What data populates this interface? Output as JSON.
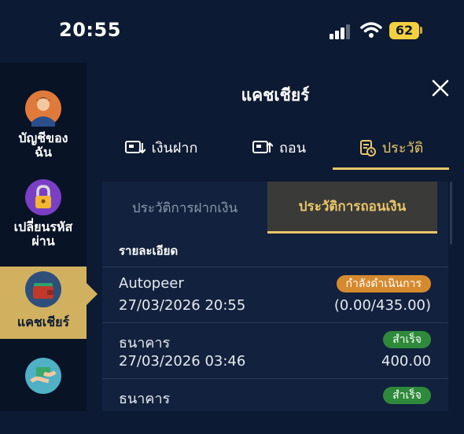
{
  "status": {
    "time": "20:55",
    "battery": "62"
  },
  "sidebar": {
    "items": [
      {
        "label": "บัญชีของฉัน",
        "icon": "user-avatar-icon"
      },
      {
        "label": "เปลี่ยนรหัสผ่าน",
        "icon": "lock-icon"
      },
      {
        "label": "แคชเชียร์",
        "icon": "wallet-icon",
        "active": true
      },
      {
        "label": "",
        "icon": "coin-exchange-icon"
      }
    ]
  },
  "header": {
    "title": "แคชเชียร์"
  },
  "tabs": [
    {
      "label": "เงินฝาก",
      "icon": "deposit-icon"
    },
    {
      "label": "ถอน",
      "icon": "withdraw-icon"
    },
    {
      "label": "ประวัติ",
      "icon": "history-icon",
      "active": true
    }
  ],
  "subtabs": [
    {
      "label": "ประวัติการฝากเงิน"
    },
    {
      "label": "ประวัติการถอนเงิน",
      "active": true
    }
  ],
  "details_header": "รายละเอียด",
  "rows": [
    {
      "name": "Autopeer",
      "date": "27/03/2026 20:55",
      "status": "กำลังดำเนินการ",
      "amount": "(0.00/435.00)"
    },
    {
      "name": "ธนาคาร",
      "date": "27/03/2026 03:46",
      "status": "สำเร็จ",
      "amount": "400.00"
    },
    {
      "name": "ธนาคาร",
      "date": "",
      "status": "สำเร็จ",
      "amount": ""
    }
  ],
  "colors": {
    "accent": "#e8c66a",
    "sidebar_active": "#d1b15f",
    "pending": "#d68a2e",
    "success": "#2e8a3a"
  }
}
